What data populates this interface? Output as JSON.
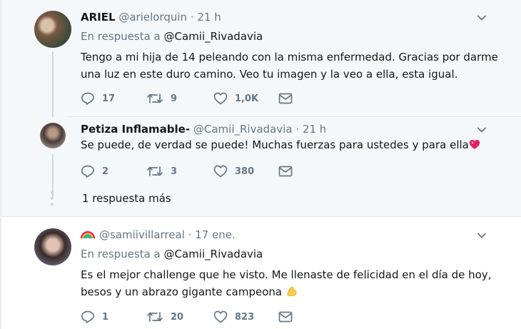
{
  "tweets": [
    {
      "name": "ARIEL",
      "handle": "@arielorquin",
      "separator": "·",
      "time": "21 h",
      "reply_prefix": "En respuesta a",
      "reply_to": "@Camii_Rivadavia",
      "text_line1": "Tengo a mi hija de 14 peleando con la misma enfermedad. Gracias por darme",
      "text_line2": "una luz en este duro camino. Veo tu imagen y la veo a ella, esta igual.",
      "replies": "17",
      "retweets": "9",
      "likes": "1,0K"
    },
    {
      "name": "Petiza Inflamable-",
      "handle": "@Camii_Rivadavia",
      "separator": "·",
      "time": "21 h",
      "text": "Se puede, de verdad se puede! Muchas fuerzas para ustedes y para ella",
      "replies": "2",
      "retweets": "3",
      "likes": "380"
    },
    {
      "name_emoji": "rainbow",
      "handle": "@samiivillarreal",
      "separator": "·",
      "time": "17 ene.",
      "reply_prefix": "En respuesta a",
      "reply_to": "@Camii_Rivadavia",
      "text_line1": "Es el mejor challenge que he visto. Me llenaste de felicidad en el día de hoy,",
      "text_line2": "besos y un abrazo gigante campeona",
      "replies": "1",
      "retweets": "20",
      "likes": "823"
    }
  ],
  "more_replies": "1 respuesta más",
  "icons": {
    "reply": "reply-icon",
    "retweet": "retweet-icon",
    "like": "heart-icon",
    "dm": "envelope-icon",
    "menu": "chevron-down-icon"
  },
  "colors": {
    "text": "#14171a",
    "secondary": "#657786",
    "thread_line": "#ccd6dd",
    "highlight_bg": "#f5f8fa"
  }
}
